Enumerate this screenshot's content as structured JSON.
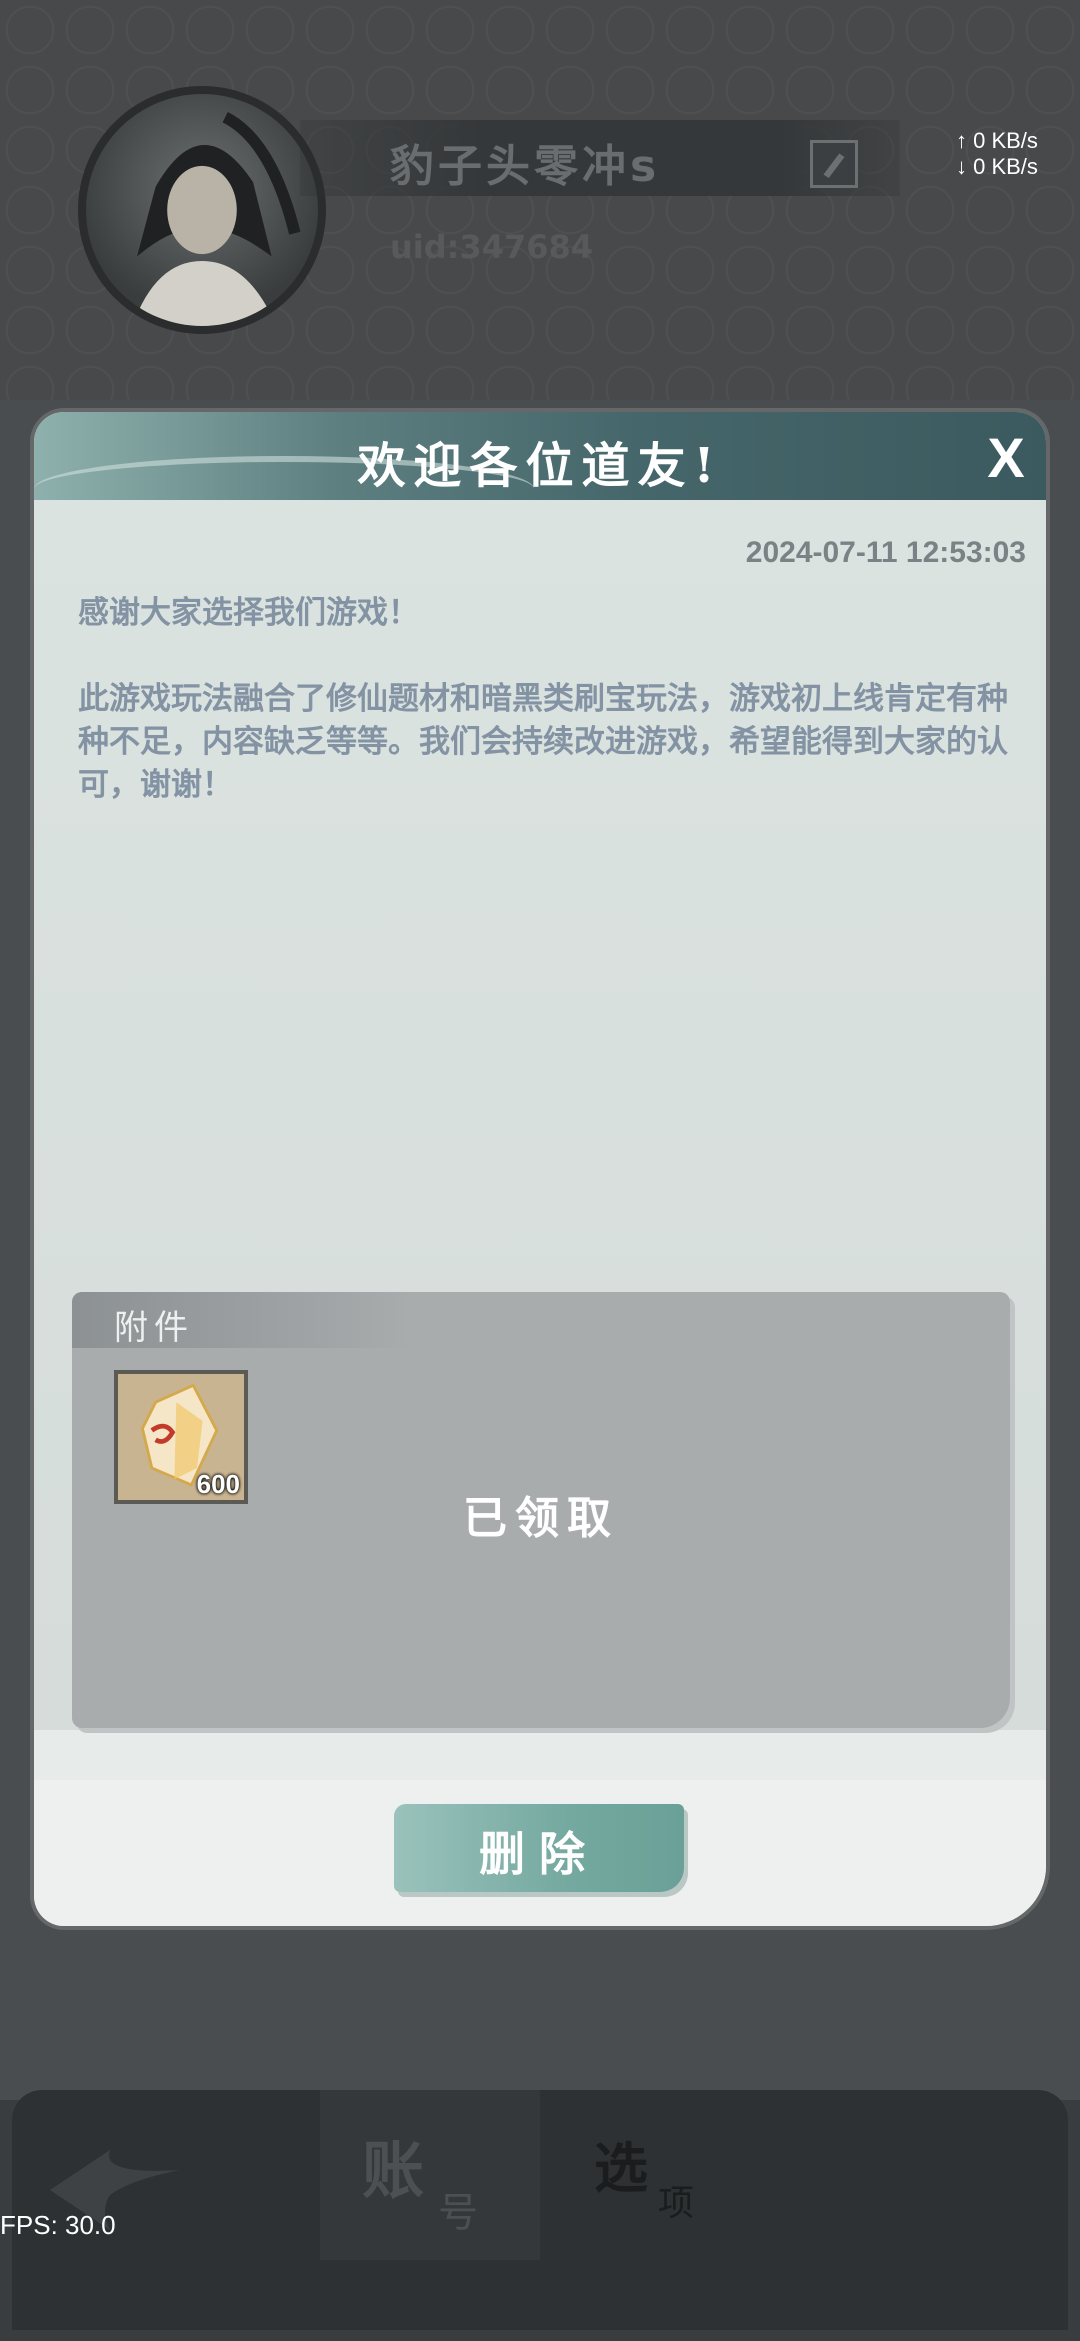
{
  "player": {
    "name": "豹子头零冲s",
    "uid": "uid:347684"
  },
  "network": {
    "upload": "↑ 0 KB/s",
    "download": "↓ 0 KB/s"
  },
  "modal": {
    "title": "欢迎各位道友!",
    "close_glyph": "X",
    "timestamp": "2024-07-11 12:53:03",
    "message": [
      "感谢大家选择我们游戏！",
      "此游戏玩法融合了修仙题材和暗黑类刷宝玩法，游戏初上线肯定有种种不足，内容缺乏等等。我们会持续改进游戏，希望能得到大家的认可，谢谢！"
    ],
    "attachment": {
      "label": "附件",
      "item_count": "600",
      "status": "已领取"
    },
    "delete_label": "删除"
  },
  "bottom_nav": {
    "account_big": "账",
    "account_small": "号",
    "options_big": "选",
    "options_small": "项"
  },
  "fps": "FPS: 30.0",
  "colors": {
    "header": "#45666a",
    "delete_button": "#74a9a0",
    "message_text": "#8393a3"
  }
}
